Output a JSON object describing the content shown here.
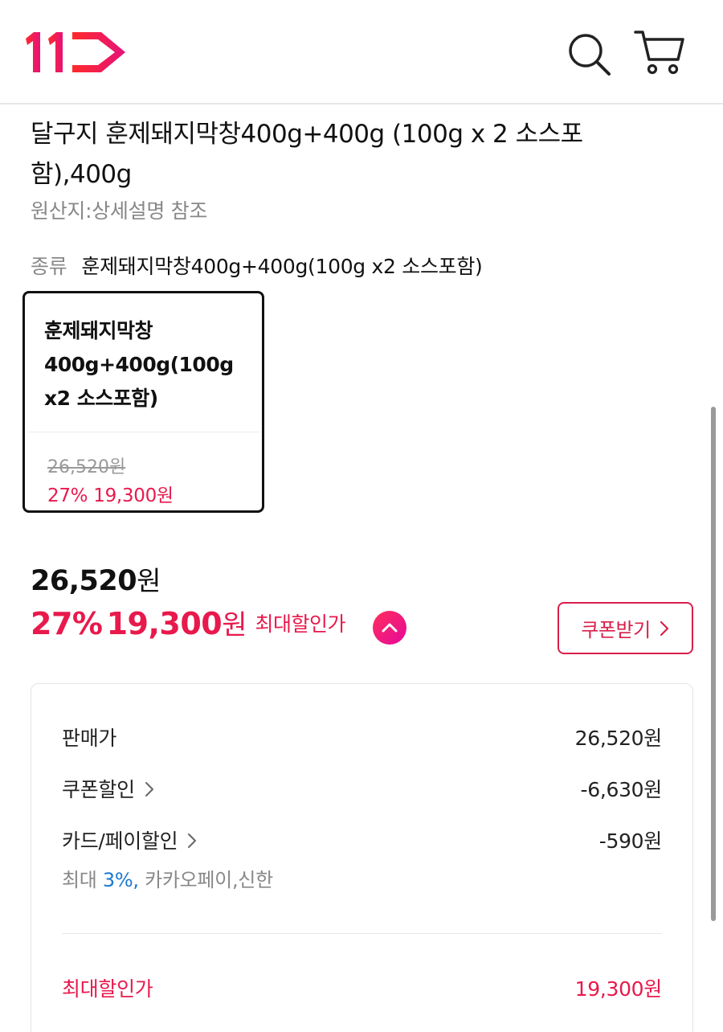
{
  "header": {
    "logo_icon": "11st-logo",
    "search_icon": "search-icon",
    "cart_icon": "cart-icon",
    "colors": {
      "logo_red": "#ff1f3d",
      "logo_pink": "#e5127a"
    }
  },
  "product": {
    "title": "달구지 훈제돼지막창400g+400g (100g x 2 소스포함),400g",
    "origin": "원산지:상세설명 참조"
  },
  "option": {
    "label": "종류",
    "selected": "훈제돼지막창400g+400g(100g x2 소스포함)",
    "card": {
      "name": "훈제돼지막창400g+400g(100g x2 소스포함)",
      "original_price": "26,520원",
      "discount_rate": "27%",
      "sale_price": "19,300원"
    }
  },
  "price": {
    "original_value": "26,520",
    "original_unit": "원",
    "discount_rate": "27%",
    "sale_value": "19,300",
    "sale_unit": "원",
    "max_label": "최대할인가",
    "coupon_button": "쿠폰받기",
    "accent_color": "#e8194c"
  },
  "breakdown": {
    "rows": [
      {
        "label": "판매가",
        "value": "26,520원"
      },
      {
        "label": "쿠폰할인",
        "value": "-6,630원"
      },
      {
        "label": "카드/페이할인",
        "value": "-590원"
      }
    ],
    "card_note_prefix": "최대",
    "card_note_pct": "3%,",
    "card_note_suffix": "카카오페이,신한",
    "total_label": "최대할인가",
    "total_value": "19,300원"
  }
}
